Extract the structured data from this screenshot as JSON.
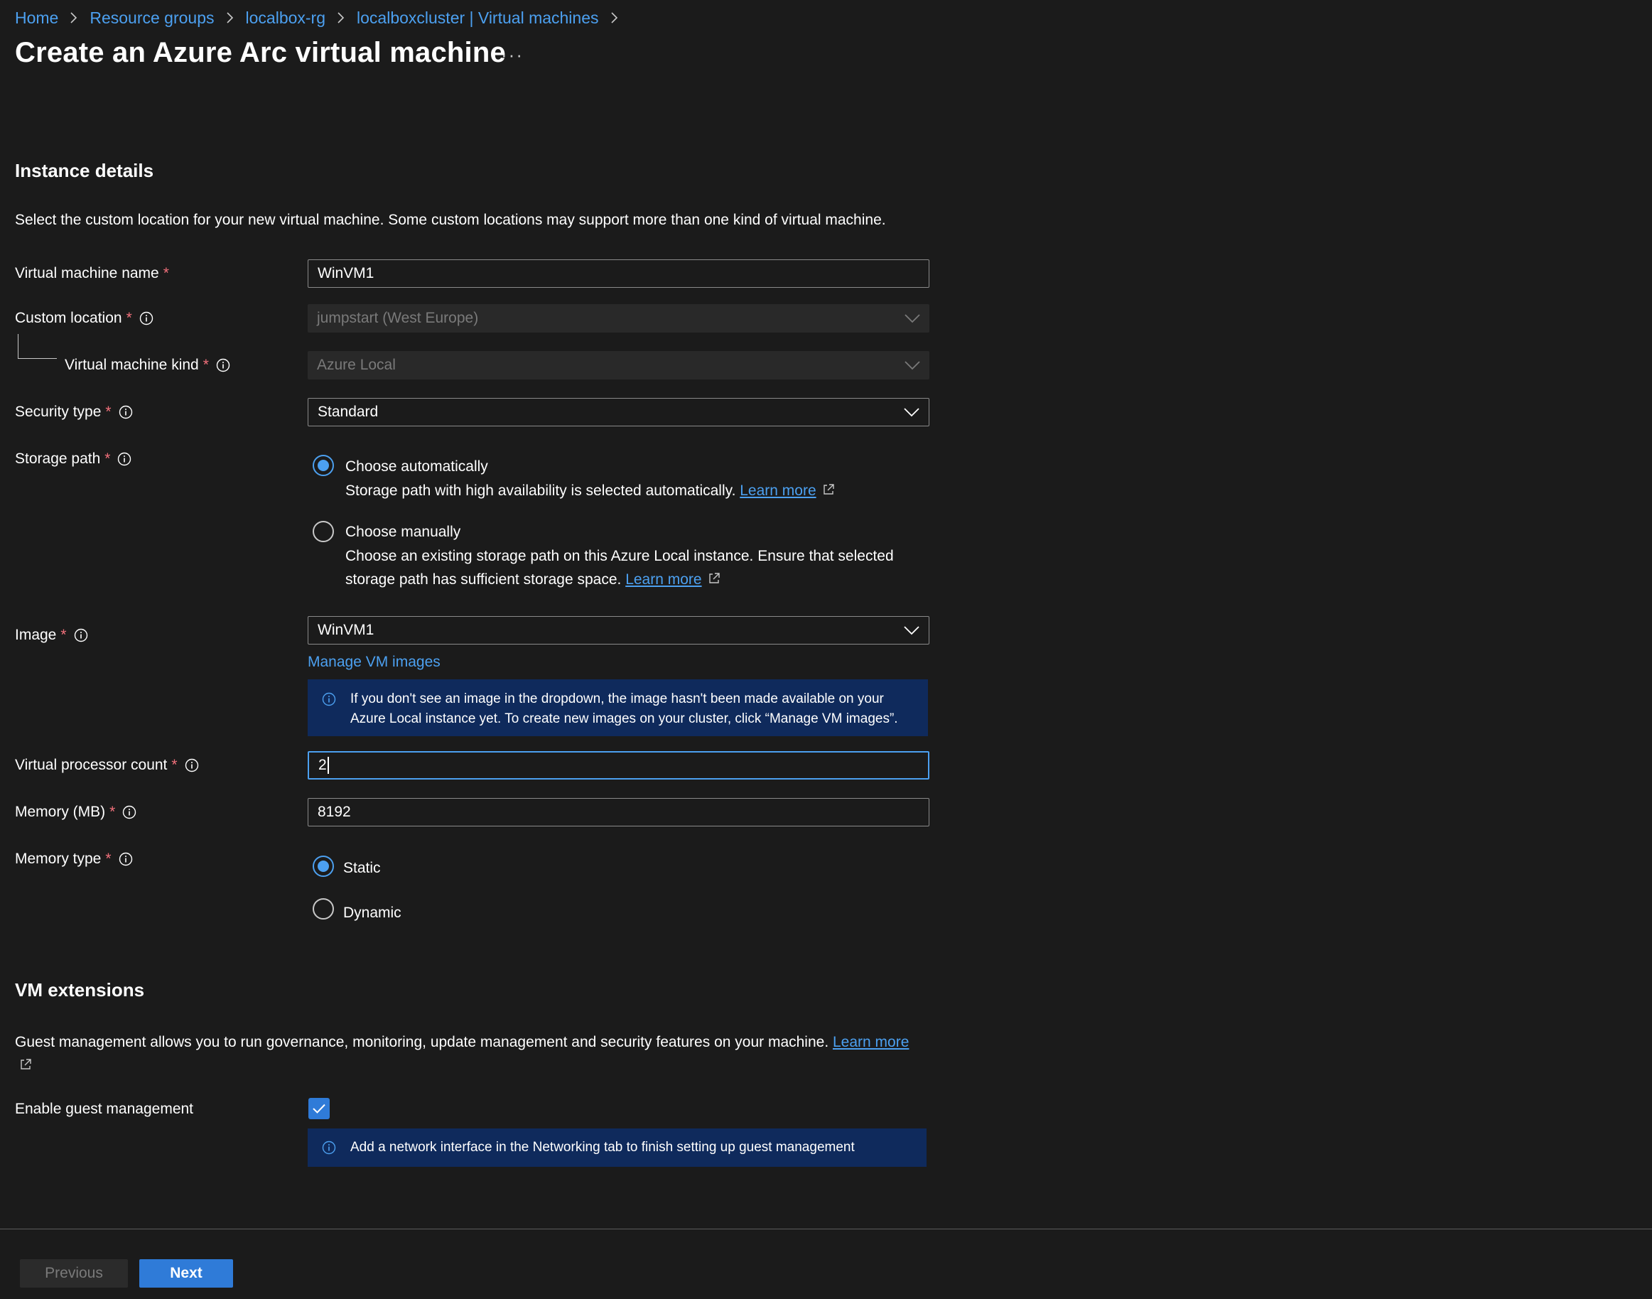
{
  "breadcrumb": {
    "items": [
      "Home",
      "Resource groups",
      "localbox-rg",
      "localboxcluster | Virtual machines"
    ]
  },
  "page": {
    "title": "Create an Azure Arc virtual machine",
    "more": "···"
  },
  "instance_details": {
    "title": "Instance details",
    "description": "Select the custom location for your new virtual machine. Some custom locations may support more than one kind of virtual machine."
  },
  "fields": {
    "vm_name": {
      "label": "Virtual machine name",
      "value": "WinVM1"
    },
    "custom_location": {
      "label": "Custom location",
      "value": "jumpstart (West Europe)"
    },
    "vm_kind": {
      "label": "Virtual machine kind",
      "value": "Azure Local"
    },
    "security_type": {
      "label": "Security type",
      "value": "Standard"
    },
    "storage_path": {
      "label": "Storage path",
      "options": [
        {
          "label": "Choose automatically",
          "description": "Storage path with high availability is selected automatically.",
          "link": "Learn more",
          "selected": true
        },
        {
          "label": "Choose manually",
          "description_line1": "Choose an existing storage path on this Azure Local instance. Ensure that selected",
          "description_line2": "storage path has sufficient storage space.",
          "link": "Learn more",
          "selected": false
        }
      ]
    },
    "image": {
      "label": "Image",
      "value": "WinVM1",
      "manage_link": "Manage VM images",
      "info_line1": "If you don't see an image in the dropdown, the image hasn't been made available on your",
      "info_line2": "Azure Local instance yet. To create new images on your cluster, click “Manage VM images”."
    },
    "vcpu": {
      "label": "Virtual processor count",
      "value": "2"
    },
    "memory": {
      "label": "Memory (MB)",
      "value": "8192"
    },
    "memory_type": {
      "label": "Memory type",
      "options": [
        {
          "label": "Static",
          "selected": true
        },
        {
          "label": "Dynamic",
          "selected": false
        }
      ]
    }
  },
  "vm_extensions": {
    "title": "VM extensions",
    "description": "Guest management allows you to run governance, monitoring, update management and security features on your machine.",
    "link": "Learn more",
    "guest_management_label": "Enable guest management",
    "guest_management_checked": true,
    "info": "Add a network interface in the Networking tab to finish setting up guest management"
  },
  "footer": {
    "previous": "Previous",
    "next": "Next"
  },
  "colors": {
    "background": "#1b1b1b",
    "link": "#4ca0f0",
    "primary_button": "#2f7bd8",
    "info_box": "#0f2a5c",
    "required": "#f1707b"
  }
}
